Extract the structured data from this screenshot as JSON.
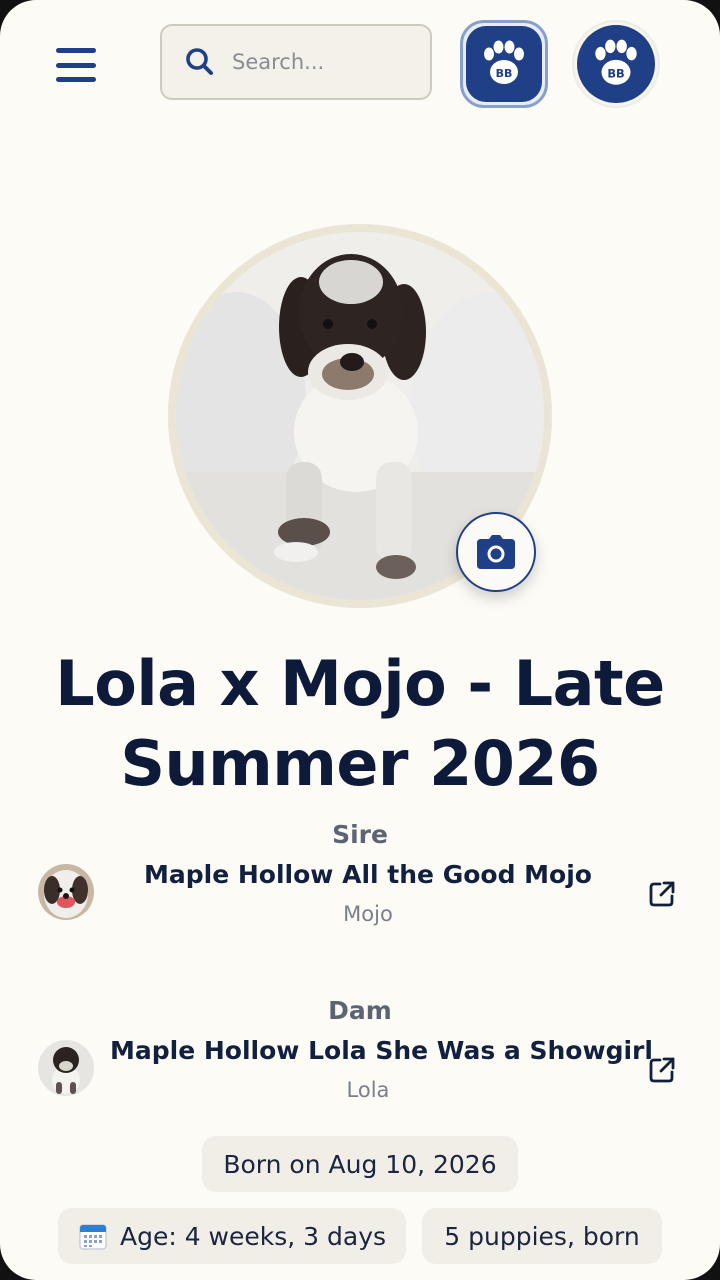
{
  "header": {
    "search_placeholder": "Search...",
    "brand_initials": "BB"
  },
  "litter": {
    "title": "Lola x Mojo - Late Summer 2026"
  },
  "sire": {
    "role_label": "Sire",
    "registered_name": "Maple Hollow All the Good Mojo",
    "call_name": "Mojo"
  },
  "dam": {
    "role_label": "Dam",
    "registered_name": "Maple Hollow Lola She Was a Showgirl",
    "call_name": "Lola"
  },
  "chips": {
    "born": "Born on Aug 10, 2026",
    "age": "Age: 4 weeks, 3 days",
    "puppies": "5 puppies, born"
  },
  "colors": {
    "brand": "#1f3f87",
    "background": "#fcfbf6"
  },
  "icons": [
    "menu-icon",
    "search-icon",
    "paw-logo-icon",
    "camera-icon",
    "external-link-icon",
    "calendar-icon"
  ]
}
